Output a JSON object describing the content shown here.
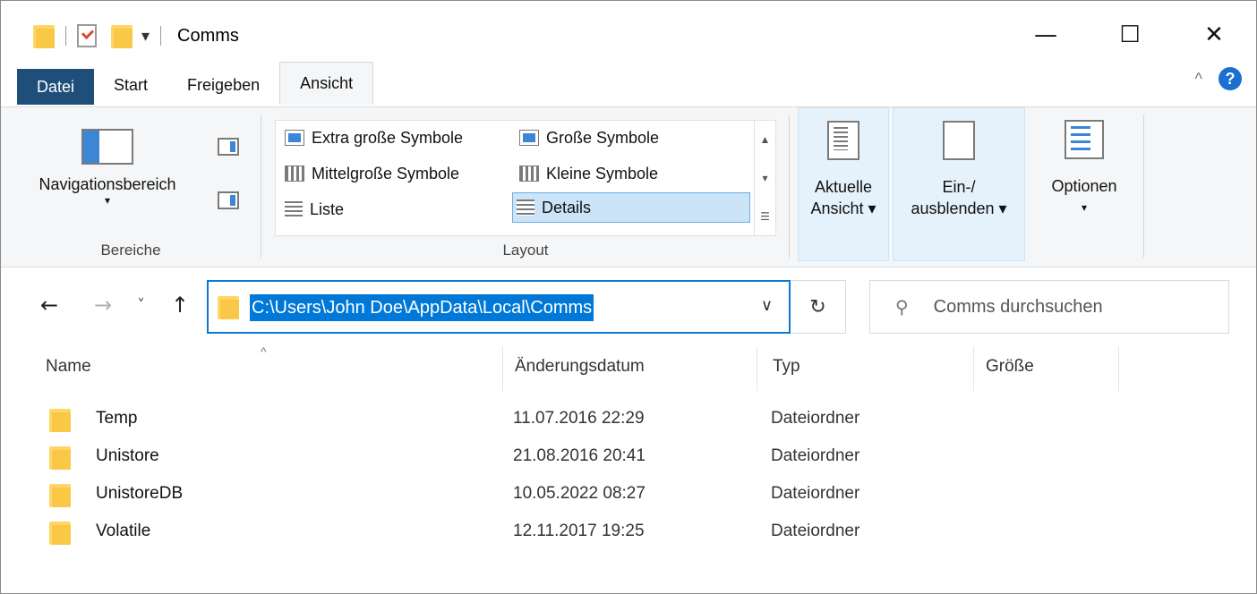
{
  "window": {
    "title": "Comms",
    "controls": {
      "minimize": "—",
      "maximize": "☐",
      "close": "✕"
    }
  },
  "quick_access": {
    "dropdown": "▾"
  },
  "tabs": [
    {
      "label": "Datei"
    },
    {
      "label": "Start"
    },
    {
      "label": "Freigeben"
    },
    {
      "label": "Ansicht"
    }
  ],
  "ribbon": {
    "collapse": "^",
    "help": "?",
    "panes": {
      "nav_label": "Navigationsbereich",
      "nav_drop": "▾",
      "group_label": "Bereiche"
    },
    "layout": {
      "group_label": "Layout",
      "items": [
        {
          "label": "Extra große Symbole"
        },
        {
          "label": "Große Symbole"
        },
        {
          "label": "Mittelgroße Symbole"
        },
        {
          "label": "Kleine Symbole"
        },
        {
          "label": "Liste"
        },
        {
          "label": "Details"
        }
      ],
      "scroll": {
        "up": "▲",
        "down": "▾",
        "more": "☰"
      }
    },
    "current_view": {
      "line1": "Aktuelle",
      "line2": "Ansicht ▾"
    },
    "show_hide": {
      "line1": "Ein-/",
      "line2": "ausblenden ▾"
    },
    "options": {
      "label": "Optionen",
      "drop": "▾"
    }
  },
  "address_bar": {
    "back": "←",
    "forward": "→",
    "recent": "˅",
    "up": "↑",
    "path": "C:\\Users\\John Doe\\AppData\\Local\\Comms",
    "dropdown": "∨",
    "refresh": "↻",
    "search_placeholder": "Comms durchsuchen",
    "search_icon": "⚲"
  },
  "file_list": {
    "sort_indicator": "^",
    "columns": [
      {
        "label": "Name"
      },
      {
        "label": "Änderungsdatum"
      },
      {
        "label": "Typ"
      },
      {
        "label": "Größe"
      }
    ],
    "rows": [
      {
        "name": "Temp",
        "modified": "11.07.2016 22:29",
        "type": "Dateiordner"
      },
      {
        "name": "Unistore",
        "modified": "21.08.2016 20:41",
        "type": "Dateiordner"
      },
      {
        "name": "UnistoreDB",
        "modified": "10.05.2022 08:27",
        "type": "Dateiordner"
      },
      {
        "name": "Volatile",
        "modified": "12.11.2017 19:25",
        "type": "Dateiordner"
      }
    ]
  }
}
